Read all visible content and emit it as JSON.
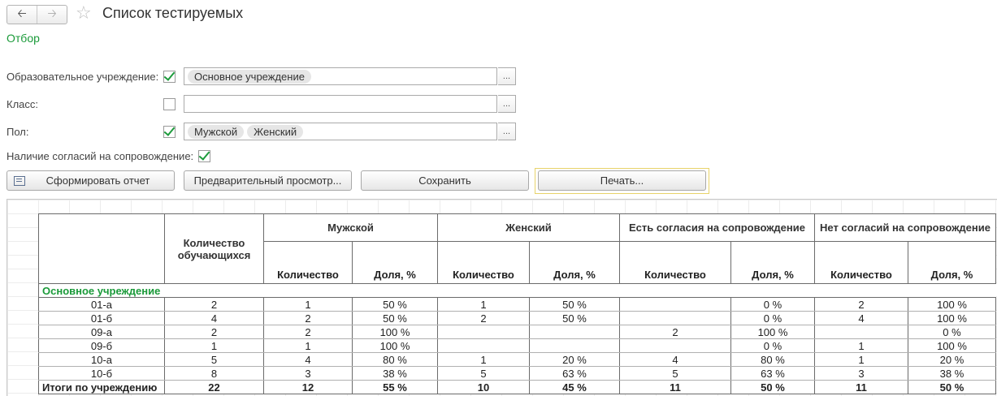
{
  "header": {
    "title": "Список тестируемых",
    "filter_link": "Отбор"
  },
  "form": {
    "institution": {
      "label": "Образовательное учреждение:",
      "checked": true,
      "tags": [
        "Основное учреждение"
      ]
    },
    "class": {
      "label": "Класс:",
      "checked": false,
      "tags": []
    },
    "gender": {
      "label": "Пол:",
      "checked": true,
      "tags": [
        "Мужской",
        "Женский"
      ]
    },
    "consent": {
      "label": "Наличие согласий на сопровождение:",
      "checked": true
    },
    "ellipsis": "..."
  },
  "buttons": {
    "generate": "Сформировать отчет",
    "preview": "Предварительный просмотр...",
    "save": "Сохранить",
    "print": "Печать..."
  },
  "report": {
    "headers": {
      "students_count": "Количество обучающихся",
      "male": "Мужской",
      "female": "Женский",
      "consent_yes": "Есть согласия на сопровождение",
      "consent_no": "Нет согласий на сопровождение",
      "count": "Количество",
      "share": "Доля, %"
    },
    "group": "Основное учреждение",
    "rows": [
      [
        "01-а",
        "2",
        "1",
        "50 %",
        "1",
        "50 %",
        "",
        "0 %",
        "2",
        "100 %"
      ],
      [
        "01-б",
        "4",
        "2",
        "50 %",
        "2",
        "50 %",
        "",
        "0 %",
        "4",
        "100 %"
      ],
      [
        "09-а",
        "2",
        "2",
        "100 %",
        "",
        "",
        "2",
        "100 %",
        "",
        "0 %"
      ],
      [
        "09-б",
        "1",
        "1",
        "100 %",
        "",
        "",
        "",
        "0 %",
        "1",
        "100 %"
      ],
      [
        "10-а",
        "5",
        "4",
        "80 %",
        "1",
        "20 %",
        "4",
        "80 %",
        "1",
        "20 %"
      ],
      [
        "10-б",
        "8",
        "3",
        "38 %",
        "5",
        "63 %",
        "5",
        "63 %",
        "3",
        "38 %"
      ]
    ],
    "total": [
      "Итоги по учреждению",
      "22",
      "12",
      "55 %",
      "10",
      "45 %",
      "11",
      "50 %",
      "11",
      "50 %"
    ]
  }
}
